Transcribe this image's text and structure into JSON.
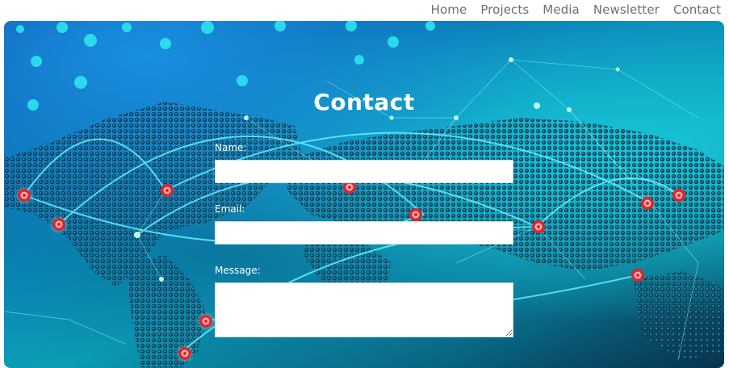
{
  "nav": {
    "items": [
      "Home",
      "Projects",
      "Media",
      "Newsletter",
      "Contact"
    ]
  },
  "contact": {
    "title": "Contact",
    "name_label": "Name:",
    "email_label": "Email:",
    "message_label": "Message:",
    "name_value": "",
    "email_value": "",
    "message_value": ""
  },
  "hero": {
    "background_description_icon": "world-map-network-icon",
    "colors": {
      "deep_blue": "#0a4fa8",
      "cyan": "#19c7d9",
      "marker_red": "#e0242d",
      "line_cyan": "#5ff0ff"
    }
  }
}
